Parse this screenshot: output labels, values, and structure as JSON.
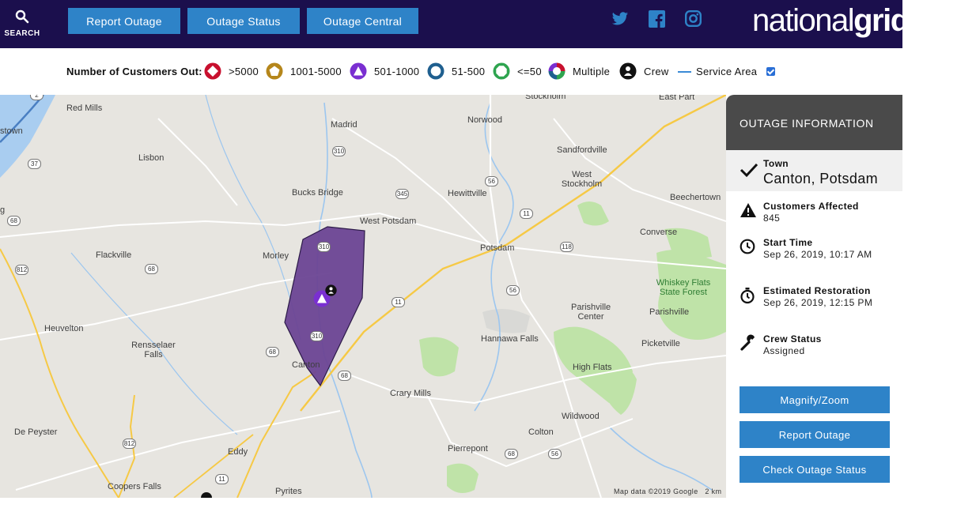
{
  "header": {
    "search_label": "SEARCH",
    "nav": [
      "Report Outage",
      "Outage Status",
      "Outage Central"
    ],
    "social": [
      "twitter-icon",
      "facebook-icon",
      "instagram-icon"
    ],
    "logo_regular": "national",
    "logo_bold": "grid"
  },
  "legend": {
    "title": "Number of Customers Out:",
    "items": [
      ">5000",
      "1001-5000",
      "501-1000",
      "51-500",
      "<=50",
      "Multiple",
      "Crew",
      "Service Area"
    ],
    "colors": {
      ">5000": "#c8102e",
      "1001-5000": "#b5861b",
      "501-1000": "#7a2fd1",
      "51-500": "#1f5f8f",
      "<=50": "#2ea44f"
    },
    "service_area_checked": true
  },
  "map": {
    "towns": [
      "Red Mills",
      "Madrid",
      "Norwood",
      "Stockholm",
      "East Part",
      "stown",
      "Lisbon",
      "Sandfordville",
      "West Stockholm",
      "Bucks Bridge",
      "Hewittville",
      "Beechertown",
      "West Potsdam",
      "Potsdam",
      "Converse",
      "g",
      "Flackville",
      "Morley",
      "Whiskey Flats State Forest",
      "Parishville Center",
      "Parishville",
      "Heuvelton",
      "Hannawa Falls",
      "Picketville",
      "Rensselaer Falls",
      "Canton",
      "High Flats",
      "Crary Mills",
      "Wildwood",
      "De Peyster",
      "Colton",
      "Eddy",
      "Pierrepont",
      "Coopers Falls",
      "Pyrites"
    ],
    "route_shields": [
      "2",
      "37",
      "68",
      "812",
      "68",
      "310",
      "345",
      "56",
      "11",
      "118",
      "56",
      "11",
      "310",
      "310",
      "68",
      "68",
      "812",
      "68",
      "56",
      "11"
    ],
    "attribution": "Map data ©2019 Google",
    "scale": "2 km"
  },
  "outage": {
    "panel_title": "OUTAGE INFORMATION",
    "town_label": "Town",
    "town_value": "Canton, Potsdam",
    "customers_label": "Customers Affected",
    "customers_value": "845",
    "start_label": "Start Time",
    "start_value": "Sep 26, 2019, 10:17 AM",
    "restore_label": "Estimated Restoration",
    "restore_value": "Sep 26, 2019, 12:15 PM",
    "crew_label": "Crew Status",
    "crew_value": "Assigned",
    "buttons": [
      "Magnify/Zoom",
      "Report Outage",
      "Check Outage Status"
    ]
  }
}
